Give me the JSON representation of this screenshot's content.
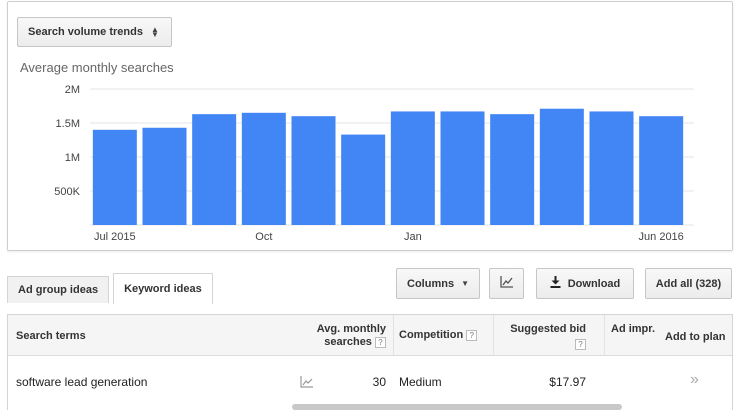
{
  "chart_dropdown": {
    "label": "Search volume trends"
  },
  "chart_data": {
    "type": "bar",
    "title": "Average monthly searches",
    "categories": [
      "Jul 2015",
      "Aug 2015",
      "Sep 2015",
      "Oct 2015",
      "Nov 2015",
      "Dec 2015",
      "Jan 2016",
      "Feb 2016",
      "Mar 2016",
      "Apr 2016",
      "May 2016",
      "Jun 2016"
    ],
    "values": [
      1400000,
      1430000,
      1630000,
      1650000,
      1600000,
      1330000,
      1670000,
      1670000,
      1630000,
      1710000,
      1670000,
      1600000
    ],
    "x_tick_labels": [
      {
        "index": 0,
        "label": "Jul 2015"
      },
      {
        "index": 3,
        "label": "Oct"
      },
      {
        "index": 6,
        "label": "Jan"
      },
      {
        "index": 11,
        "label": "Jun 2016"
      }
    ],
    "y_ticks": [
      {
        "value": 500000,
        "label": "500K"
      },
      {
        "value": 1000000,
        "label": "1M"
      },
      {
        "value": 1500000,
        "label": "1.5M"
      },
      {
        "value": 2000000,
        "label": "2M"
      }
    ],
    "ylim": [
      0,
      2000000
    ],
    "grid": true,
    "bar_color": "#4285f4"
  },
  "tabs": [
    {
      "label": "Ad group ideas",
      "active": false
    },
    {
      "label": "Keyword ideas",
      "active": true
    }
  ],
  "toolbar": {
    "columns_label": "Columns",
    "download_label": "Download",
    "add_all_label": "Add all (328)"
  },
  "table": {
    "headers": {
      "search_terms": "Search terms",
      "avg_monthly_line1": "Avg. monthly",
      "avg_monthly_line2": "searches",
      "competition": "Competition",
      "suggested_bid": "Suggested bid",
      "ad_impr": "Ad impr.",
      "add_to_plan": "Add to plan",
      "help_glyph": "?"
    },
    "rows": [
      {
        "term": "software lead generation",
        "avg_searches": "30",
        "competition": "Medium",
        "suggested_bid": "$17.97",
        "add_glyph": "»"
      }
    ]
  }
}
